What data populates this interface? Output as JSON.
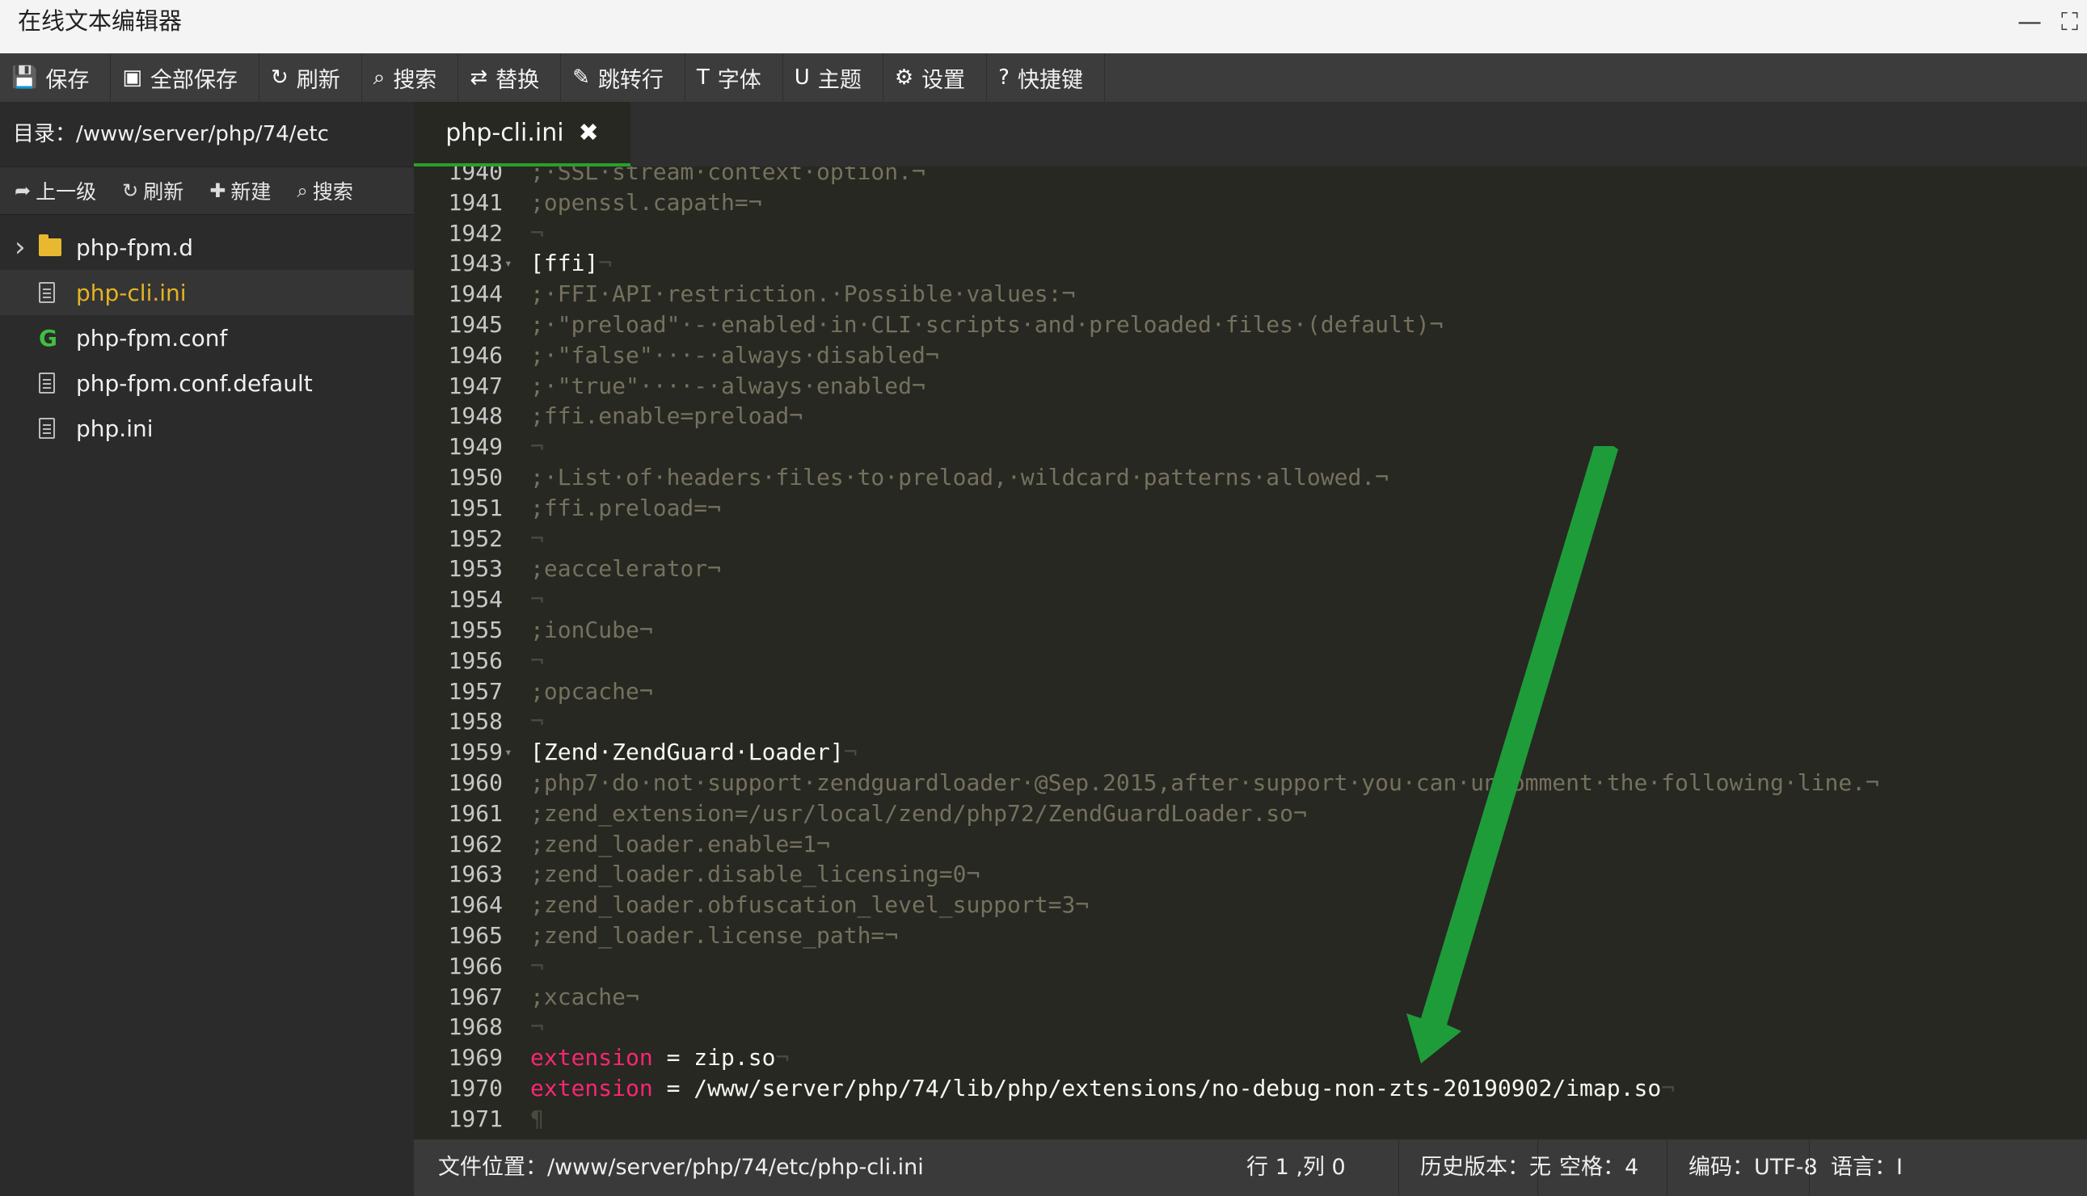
{
  "window": {
    "title": "在线文本编辑器",
    "minimize": "—",
    "maximize": "⛶"
  },
  "toolbar": [
    {
      "icon": "save-icon",
      "glyph": "💾",
      "label": "保存"
    },
    {
      "icon": "save-all-icon",
      "glyph": "▣",
      "label": "全部保存"
    },
    {
      "icon": "refresh-icon",
      "glyph": "↻",
      "label": "刷新"
    },
    {
      "icon": "search-icon",
      "glyph": "⌕",
      "label": "搜索"
    },
    {
      "icon": "replace-icon",
      "glyph": "⇄",
      "label": "替换"
    },
    {
      "icon": "pin-icon",
      "glyph": "✎",
      "label": "跳转行"
    },
    {
      "icon": "font-icon",
      "glyph": "T",
      "label": "字体"
    },
    {
      "icon": "magnet-icon",
      "glyph": "U",
      "label": "主题"
    },
    {
      "icon": "gear-icon",
      "glyph": "⚙",
      "label": "设置"
    },
    {
      "icon": "help-icon",
      "glyph": "?",
      "label": "快捷键"
    }
  ],
  "sidebar": {
    "directory": "目录：/www/server/php/74/etc",
    "actions": [
      {
        "icon": "up-level-icon",
        "glyph": "➦",
        "label": "上一级"
      },
      {
        "icon": "refresh-icon",
        "glyph": "↻",
        "label": "刷新"
      },
      {
        "icon": "plus-icon",
        "glyph": "✚",
        "label": "新建"
      },
      {
        "icon": "search-icon",
        "glyph": "⌕",
        "label": "搜索"
      }
    ],
    "files": [
      {
        "name": "php-fpm.d",
        "type": "folder",
        "icon": "folder-icon",
        "active": false
      },
      {
        "name": "php-cli.ini",
        "type": "file",
        "icon": "file-icon",
        "active": true
      },
      {
        "name": "php-fpm.conf",
        "type": "file",
        "icon": "g-file-icon",
        "active": false
      },
      {
        "name": "php-fpm.conf.default",
        "type": "file",
        "icon": "file-icon",
        "active": false
      },
      {
        "name": "php.ini",
        "type": "file",
        "icon": "file-icon",
        "active": false
      }
    ],
    "collapse_glyph": "‹"
  },
  "editor": {
    "tab": {
      "label": "php-cli.ini",
      "close": "✖"
    },
    "lines": [
      {
        "n": "1940",
        "t": ";·SSL·stream·context·option.¬",
        "k": "cmt"
      },
      {
        "n": "1941",
        "t": ";openssl.capath=¬",
        "k": "cmt"
      },
      {
        "n": "1942",
        "t": "¬",
        "k": "inv"
      },
      {
        "n": "1943",
        "t": "[ffi]",
        "k": "sec",
        "fold": true,
        "eol": "¬"
      },
      {
        "n": "1944",
        "t": ";·FFI·API·restriction.·Possible·values:¬",
        "k": "cmt"
      },
      {
        "n": "1945",
        "t": ";·\"preload\"·-·enabled·in·CLI·scripts·and·preloaded·files·(default)¬",
        "k": "cmt"
      },
      {
        "n": "1946",
        "t": ";·\"false\"···-·always·disabled¬",
        "k": "cmt"
      },
      {
        "n": "1947",
        "t": ";·\"true\"····-·always·enabled¬",
        "k": "cmt"
      },
      {
        "n": "1948",
        "t": ";ffi.enable=preload¬",
        "k": "cmt"
      },
      {
        "n": "1949",
        "t": "¬",
        "k": "inv"
      },
      {
        "n": "1950",
        "t": ";·List·of·headers·files·to·preload,·wildcard·patterns·allowed.¬",
        "k": "cmt"
      },
      {
        "n": "1951",
        "t": ";ffi.preload=¬",
        "k": "cmt"
      },
      {
        "n": "1952",
        "t": "¬",
        "k": "inv"
      },
      {
        "n": "1953",
        "t": ";eaccelerator¬",
        "k": "cmt"
      },
      {
        "n": "1954",
        "t": "¬",
        "k": "inv"
      },
      {
        "n": "1955",
        "t": ";ionCube¬",
        "k": "cmt"
      },
      {
        "n": "1956",
        "t": "¬",
        "k": "inv"
      },
      {
        "n": "1957",
        "t": ";opcache¬",
        "k": "cmt"
      },
      {
        "n": "1958",
        "t": "¬",
        "k": "inv"
      },
      {
        "n": "1959",
        "t": "[Zend·ZendGuard·Loader]",
        "k": "sec",
        "fold": true,
        "eol": "¬"
      },
      {
        "n": "1960",
        "t": ";php7·do·not·support·zendguardloader·@Sep.2015,after·support·you·can·uncomment·the·following·line.¬",
        "k": "cmt"
      },
      {
        "n": "1961",
        "t": ";zend_extension=/usr/local/zend/php72/ZendGuardLoader.so¬",
        "k": "cmt"
      },
      {
        "n": "1962",
        "t": ";zend_loader.enable=1¬",
        "k": "cmt"
      },
      {
        "n": "1963",
        "t": ";zend_loader.disable_licensing=0¬",
        "k": "cmt"
      },
      {
        "n": "1964",
        "t": ";zend_loader.obfuscation_level_support=3¬",
        "k": "cmt"
      },
      {
        "n": "1965",
        "t": ";zend_loader.license_path=¬",
        "k": "cmt"
      },
      {
        "n": "1966",
        "t": "¬",
        "k": "inv"
      },
      {
        "n": "1967",
        "t": ";xcache¬",
        "k": "cmt"
      },
      {
        "n": "1968",
        "t": "¬",
        "k": "inv"
      },
      {
        "n": "1969",
        "t": "",
        "k": "ext",
        "key": "extension",
        "val": "zip.so",
        "eol": "¬"
      },
      {
        "n": "1970",
        "t": "",
        "k": "ext",
        "key": "extension",
        "val": "/www/server/php/74/lib/php/extensions/no-debug-non-zts-20190902/imap.so",
        "eol": "¬"
      },
      {
        "n": "1971",
        "t": "¶",
        "k": "inv"
      }
    ]
  },
  "statusbar": {
    "file_path": "文件位置：/www/server/php/74/etc/php-cli.ini",
    "cursor": "行 1 ,列 0",
    "history": "历史版本：无",
    "spaces": "空格：4",
    "encoding": "编码：UTF-8",
    "language": "语言：I"
  },
  "colors": {
    "arrow": "#1e9c3a",
    "accent_tab": "#2aa02a",
    "keyword": "#f92672",
    "comment": "#75715e",
    "active_file": "#e6b422"
  }
}
